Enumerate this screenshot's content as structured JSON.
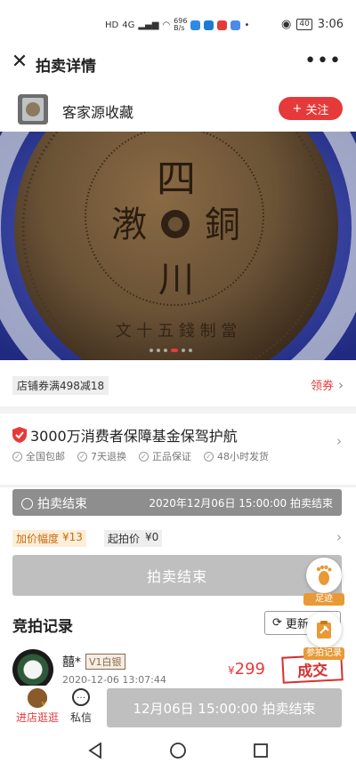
{
  "status_bar": {
    "left_labels": [
      "HD",
      "4G"
    ],
    "net_speed": "696\nB/s",
    "battery": "40",
    "time": "3:06"
  },
  "titlebar": {
    "title": "拍卖详情",
    "close_icon": "close-icon",
    "more_icon": "more-icon"
  },
  "shop": {
    "name": "客家源收藏",
    "follow_label": "关注"
  },
  "gallery": {
    "count": 6,
    "active_index": 3
  },
  "coupon": {
    "tag": "店铺券满498减18",
    "link_label": "领券"
  },
  "guarantee": {
    "title": "3000万消费者保障基金保驾护航",
    "items": [
      "全国包邮",
      "7天退换",
      "正品保证",
      "48小时发货"
    ]
  },
  "auction": {
    "status_label": "拍卖结束",
    "end_time": "2020年12月06日 15:00:00 拍卖结束",
    "increment_label": "加价幅度",
    "increment_value": "¥13",
    "start_label": "起拍价",
    "start_value": "¥0",
    "ended_button": "拍卖结束"
  },
  "records": {
    "title": "竞拍记录",
    "refresh_label": "更新",
    "bid": {
      "name": "囍*",
      "level": "V1白银",
      "time": "2020-12-06 13:07:44",
      "currency": "¥",
      "price": "299",
      "stamp": "成交"
    }
  },
  "floating": {
    "footprint_label": "足迹",
    "bid_label": "参拍记录"
  },
  "actionbar": {
    "shop_label": "进店逛逛",
    "message_label": "私信",
    "main_button": "12月06日 15:00:00 拍卖结束"
  },
  "colors": {
    "accent": "#e63a3a",
    "disabled": "#bfbfbf",
    "status_gray": "#8e8e8e"
  }
}
